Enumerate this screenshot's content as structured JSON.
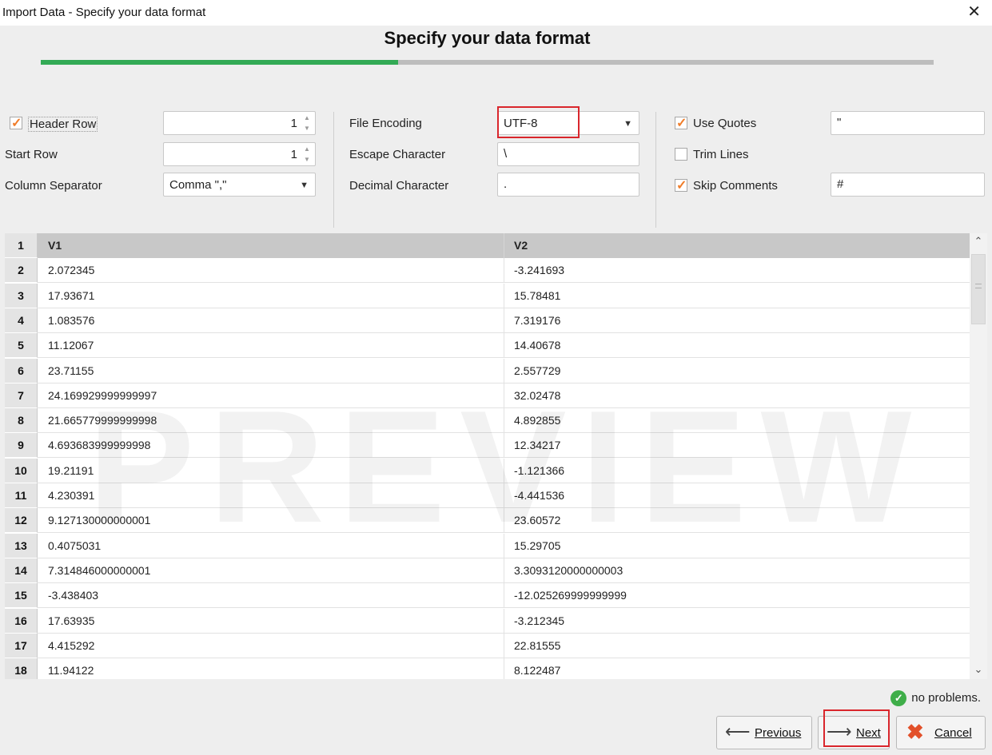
{
  "window": {
    "title": "Import Data - Specify your data format",
    "close_glyph": "✕"
  },
  "heading": "Specify your data format",
  "progress": {
    "percent": 40
  },
  "options": {
    "header_row": {
      "label": "Header Row",
      "checked": true,
      "value": "1"
    },
    "start_row": {
      "label": "Start Row",
      "value": "1"
    },
    "column_separator": {
      "label": "Column Separator",
      "value": "Comma \",\""
    },
    "file_encoding": {
      "label": "File Encoding",
      "value": "UTF-8"
    },
    "escape_character": {
      "label": "Escape Character",
      "value": "\\"
    },
    "decimal_character": {
      "label": "Decimal Character",
      "value": "."
    },
    "use_quotes": {
      "label": "Use Quotes",
      "checked": true,
      "value": "\""
    },
    "trim_lines": {
      "label": "Trim Lines",
      "checked": false
    },
    "skip_comments": {
      "label": "Skip Comments",
      "checked": true,
      "value": "#"
    }
  },
  "preview": {
    "watermark": "PREVIEW",
    "rows": [
      {
        "n": "1",
        "v1": "V1",
        "v2": "V2"
      },
      {
        "n": "2",
        "v1": "2.072345",
        "v2": "-3.241693"
      },
      {
        "n": "3",
        "v1": "17.93671",
        "v2": "15.78481"
      },
      {
        "n": "4",
        "v1": "1.083576",
        "v2": "7.319176"
      },
      {
        "n": "5",
        "v1": "11.12067",
        "v2": "14.40678"
      },
      {
        "n": "6",
        "v1": "23.71155",
        "v2": "2.557729"
      },
      {
        "n": "7",
        "v1": "24.169929999999997",
        "v2": "32.02478"
      },
      {
        "n": "8",
        "v1": "21.665779999999998",
        "v2": "4.892855"
      },
      {
        "n": "9",
        "v1": "4.693683999999998",
        "v2": "12.34217"
      },
      {
        "n": "10",
        "v1": "19.21191",
        "v2": "-1.121366"
      },
      {
        "n": "11",
        "v1": "4.230391",
        "v2": "-4.441536"
      },
      {
        "n": "12",
        "v1": "9.127130000000001",
        "v2": "23.60572"
      },
      {
        "n": "13",
        "v1": "0.4075031",
        "v2": "15.29705"
      },
      {
        "n": "14",
        "v1": "7.314846000000001",
        "v2": "3.3093120000000003"
      },
      {
        "n": "15",
        "v1": "-3.438403",
        "v2": "-12.025269999999999"
      },
      {
        "n": "16",
        "v1": "17.63935",
        "v2": "-3.212345"
      },
      {
        "n": "17",
        "v1": "4.415292",
        "v2": "22.81555"
      },
      {
        "n": "18",
        "v1": "11.94122",
        "v2": "8.122487"
      }
    ]
  },
  "status": {
    "text": "no problems.",
    "icon": "check-circle-icon"
  },
  "buttons": {
    "previous": {
      "label": "Previous",
      "icon": "arrow-left-icon"
    },
    "next": {
      "label": "Next",
      "icon": "arrow-right-icon"
    },
    "cancel": {
      "label": "Cancel",
      "icon": "x-icon"
    }
  },
  "colors": {
    "accent": "#33aa55",
    "checkmark": "#f07d2a",
    "highlight": "#d9262c",
    "cancel_icon": "#e2502a"
  }
}
